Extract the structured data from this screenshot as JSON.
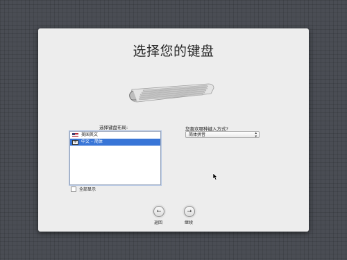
{
  "window": {
    "title": "选择您的键盘"
  },
  "layout": {
    "label": "选择键盘布局:",
    "items": [
      {
        "label": "美国英文",
        "icon": "us-flag-icon",
        "selected": false
      },
      {
        "label": "中文 – 简体",
        "icon": "pinyin-input-icon",
        "selected": true
      }
    ],
    "show_all_label": "全部显示"
  },
  "input_method": {
    "question": "您喜欢哪种键入方式?",
    "selected": "简体拼音"
  },
  "nav": {
    "back_label": "返回",
    "continue_label": "继续"
  },
  "colors": {
    "selection": "#3875d7",
    "panel": "#ededed",
    "background": "#4a4d54"
  }
}
